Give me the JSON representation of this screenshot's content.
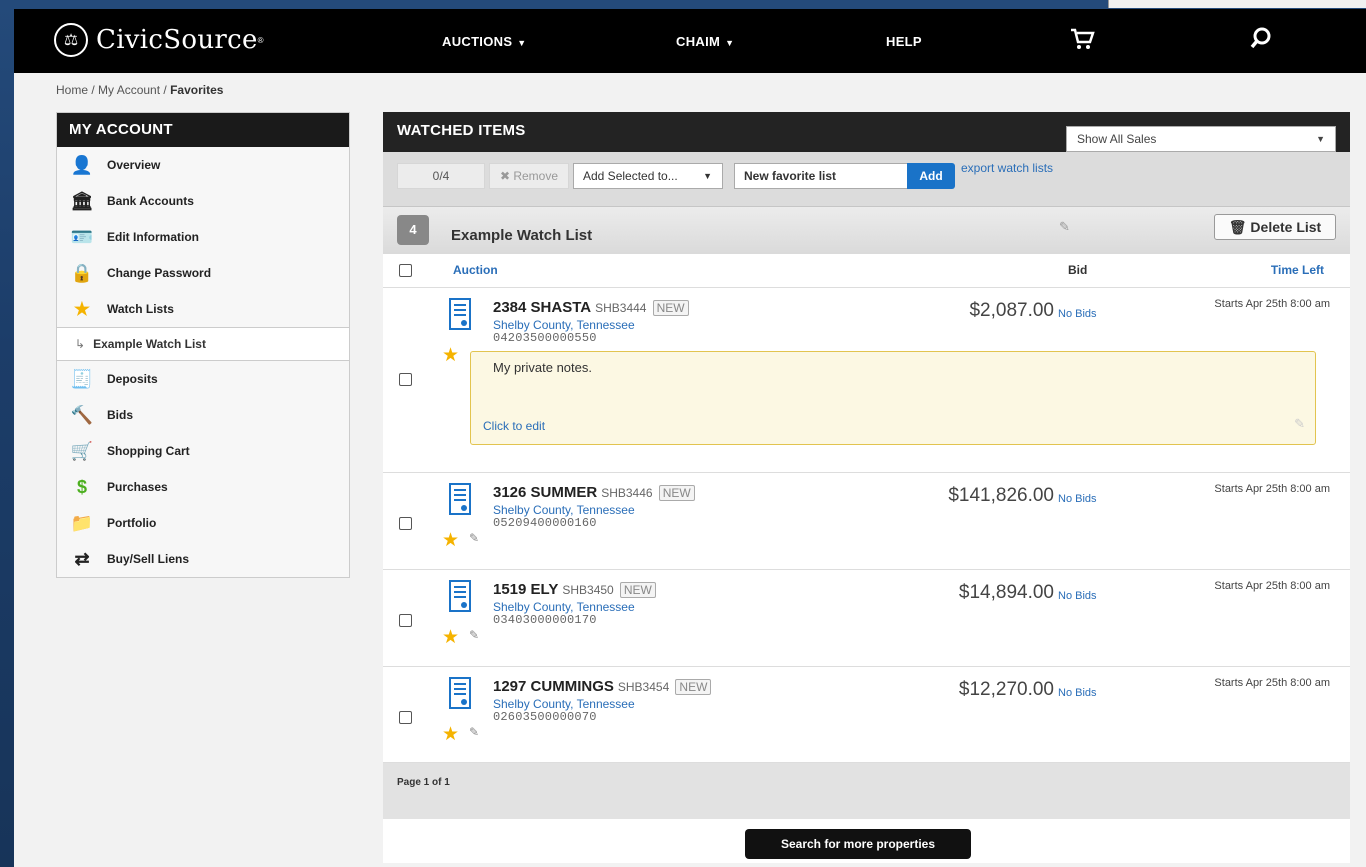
{
  "brand": {
    "name": "CivicSource"
  },
  "nav": {
    "auctions": "AUCTIONS",
    "user": "CHAIM",
    "help": "HELP"
  },
  "breadcrumb": {
    "home": "Home",
    "account": "My Account",
    "current": "Favorites"
  },
  "sidebar": {
    "title": "MY ACCOUNT",
    "items": [
      {
        "label": "Overview",
        "icon": "person-icon"
      },
      {
        "label": "Bank Accounts",
        "icon": "bank-icon"
      },
      {
        "label": "Edit Information",
        "icon": "id-card-icon"
      },
      {
        "label": "Change Password",
        "icon": "lock-icon"
      },
      {
        "label": "Watch Lists",
        "icon": "star-icon"
      },
      {
        "label": "Deposits",
        "icon": "deposit-icon"
      },
      {
        "label": "Bids",
        "icon": "gavel-icon"
      },
      {
        "label": "Shopping Cart",
        "icon": "cart-icon"
      },
      {
        "label": "Purchases",
        "icon": "dollar-icon"
      },
      {
        "label": "Portfolio",
        "icon": "folder-icon"
      },
      {
        "label": "Buy/Sell Liens",
        "icon": "swap-icon"
      }
    ],
    "subitem": "Example Watch List"
  },
  "watched": {
    "title": "WATCHED ITEMS",
    "filter": "Show All Sales",
    "count": "0/4",
    "remove": "Remove",
    "add_selected": "Add Selected to...",
    "new_list_placeholder": "New favorite list",
    "add": "Add",
    "export": "export watch lists"
  },
  "list": {
    "count": "4",
    "name": "Example Watch List",
    "delete": "Delete List",
    "col_auction": "Auction",
    "col_bid": "Bid",
    "col_time": "Time Left"
  },
  "items": [
    {
      "address": "2384 SHASTA",
      "code": "SHB3444",
      "tag": "NEW",
      "county": "Shelby County, Tennessee",
      "parcel": "04203500000550",
      "price": "$2,087.00",
      "bids": "No Bids",
      "time": "Starts Apr 25th 8:00 am",
      "note": "My private notes.",
      "note_edit": "Click to edit"
    },
    {
      "address": "3126 SUMMER",
      "code": "SHB3446",
      "tag": "NEW",
      "county": "Shelby County, Tennessee",
      "parcel": "05209400000160",
      "price": "$141,826.00",
      "bids": "No Bids",
      "time": "Starts Apr 25th 8:00 am"
    },
    {
      "address": "1519 ELY",
      "code": "SHB3450",
      "tag": "NEW",
      "county": "Shelby County, Tennessee",
      "parcel": "03403000000170",
      "price": "$14,894.00",
      "bids": "No Bids",
      "time": "Starts Apr 25th 8:00 am"
    },
    {
      "address": "1297 CUMMINGS",
      "code": "SHB3454",
      "tag": "NEW",
      "county": "Shelby County, Tennessee",
      "parcel": "02603500000070",
      "price": "$12,270.00",
      "bids": "No Bids",
      "time": "Starts Apr 25th 8:00 am"
    }
  ],
  "pager": "Page 1 of 1",
  "search_more": "Search for more properties"
}
